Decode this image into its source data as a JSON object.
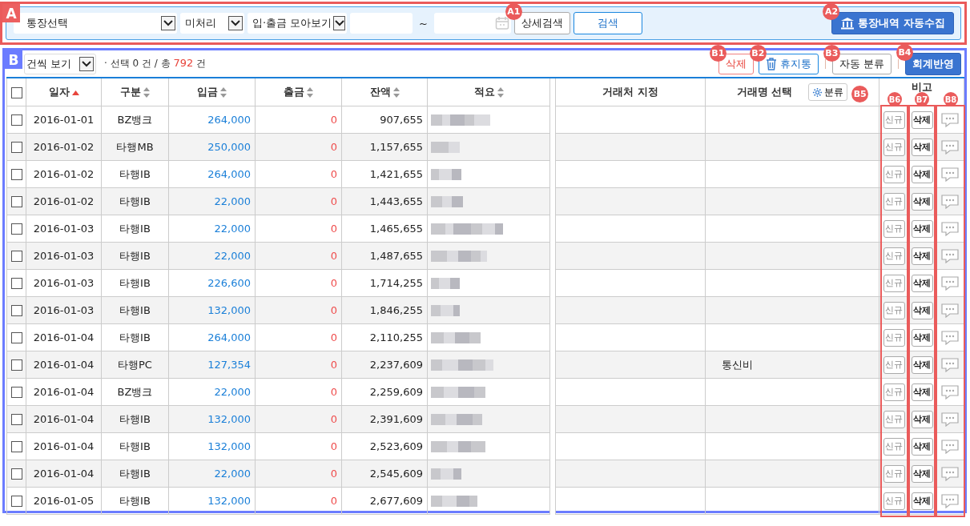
{
  "search_bar": {
    "callout": "A",
    "account_select": {
      "value": "통장선택"
    },
    "status_select": {
      "value": "미처리"
    },
    "view_select": {
      "value": "입·출금 모아보기"
    },
    "date_separator": "~",
    "buttons": [
      {
        "label": "상세검색",
        "kind": "outline",
        "callout": "A1"
      },
      {
        "label": "검색",
        "kind": "primary-outline"
      }
    ],
    "auto_collect": {
      "label": "통장내역 자동수집",
      "callout": "A2"
    }
  },
  "list_toolbar": {
    "callout": "B",
    "page_size_select": {
      "value": "건씩 보기"
    },
    "summary": {
      "prefix": "· 선택 0 건 / 총",
      "total": "792",
      "suffix": "건"
    },
    "actions": [
      {
        "label": "삭제",
        "kind": "danger",
        "callout": "B1"
      },
      {
        "label": "휴지통",
        "kind": "trash",
        "callout": "B2"
      },
      {
        "label": "자동 분류",
        "kind": "outline",
        "callout": "B3"
      },
      {
        "label": "회계반영",
        "kind": "primary",
        "callout": "B4"
      }
    ]
  },
  "table": {
    "select_all": {
      "checked": false
    },
    "columns": [
      {
        "label": "일자",
        "sort_active": true
      },
      {
        "label": "구분",
        "sort_active": false
      },
      {
        "label": "입금",
        "sort_active": false
      },
      {
        "label": "출금",
        "sort_active": false
      },
      {
        "label": "잔액",
        "sort_active": false
      },
      {
        "label": "적요",
        "sort_active": false
      },
      {
        "label": "거래처 지정"
      },
      {
        "label": "거래명 선택",
        "classify_button": {
          "label": "분류",
          "callout": "B5"
        }
      },
      {
        "label": "비고"
      }
    ],
    "row_action_callouts": [
      "B6",
      "B7",
      "B8"
    ],
    "rows": [
      {
        "checked": false,
        "date": "2016-01-01",
        "type": "BZ뱅크",
        "deposit": "264,000",
        "withdrawal": "0",
        "balance": "907,655",
        "new_label": "신규",
        "delete_label": "삭제"
      },
      {
        "checked": false,
        "date": "2016-01-02",
        "type": "타행MB",
        "deposit": "250,000",
        "withdrawal": "0",
        "balance": "1,157,655",
        "new_label": "신규",
        "delete_label": "삭제"
      },
      {
        "checked": false,
        "date": "2016-01-02",
        "type": "타행IB",
        "deposit": "264,000",
        "withdrawal": "0",
        "balance": "1,421,655",
        "new_label": "신규",
        "delete_label": "삭제"
      },
      {
        "checked": false,
        "date": "2016-01-02",
        "type": "타행IB",
        "deposit": "22,000",
        "withdrawal": "0",
        "balance": "1,443,655",
        "new_label": "신규",
        "delete_label": "삭제"
      },
      {
        "checked": false,
        "date": "2016-01-03",
        "type": "타행IB",
        "deposit": "22,000",
        "withdrawal": "0",
        "balance": "1,465,655",
        "new_label": "신규",
        "delete_label": "삭제"
      },
      {
        "checked": false,
        "date": "2016-01-03",
        "type": "타행IB",
        "deposit": "22,000",
        "withdrawal": "0",
        "balance": "1,487,655",
        "new_label": "신규",
        "delete_label": "삭제"
      },
      {
        "checked": false,
        "date": "2016-01-03",
        "type": "타행IB",
        "deposit": "226,600",
        "withdrawal": "0",
        "balance": "1,714,255",
        "new_label": "신규",
        "delete_label": "삭제"
      },
      {
        "checked": false,
        "date": "2016-01-03",
        "type": "타행IB",
        "deposit": "132,000",
        "withdrawal": "0",
        "balance": "1,846,255",
        "new_label": "신규",
        "delete_label": "삭제"
      },
      {
        "checked": false,
        "date": "2016-01-04",
        "type": "타행IB",
        "deposit": "264,000",
        "withdrawal": "0",
        "balance": "2,110,255",
        "new_label": "신규",
        "delete_label": "삭제"
      },
      {
        "checked": false,
        "date": "2016-01-04",
        "type": "타행PC",
        "deposit": "127,354",
        "withdrawal": "0",
        "balance": "2,237,609",
        "transaction_name": "통신비",
        "new_label": "신규",
        "delete_label": "삭제"
      },
      {
        "checked": false,
        "date": "2016-01-04",
        "type": "BZ뱅크",
        "deposit": "22,000",
        "withdrawal": "0",
        "balance": "2,259,609",
        "new_label": "신규",
        "delete_label": "삭제"
      },
      {
        "checked": false,
        "date": "2016-01-04",
        "type": "타행IB",
        "deposit": "132,000",
        "withdrawal": "0",
        "balance": "2,391,609",
        "new_label": "신규",
        "delete_label": "삭제"
      },
      {
        "checked": false,
        "date": "2016-01-04",
        "type": "타행IB",
        "deposit": "132,000",
        "withdrawal": "0",
        "balance": "2,523,609",
        "new_label": "신규",
        "delete_label": "삭제"
      },
      {
        "checked": false,
        "date": "2016-01-04",
        "type": "타행IB",
        "deposit": "22,000",
        "withdrawal": "0",
        "balance": "2,545,609",
        "new_label": "신규",
        "delete_label": "삭제"
      },
      {
        "checked": false,
        "date": "2016-01-05",
        "type": "타행IB",
        "deposit": "132,000",
        "withdrawal": "0",
        "balance": "2,677,609",
        "new_label": "신규",
        "delete_label": "삭제"
      }
    ]
  }
}
